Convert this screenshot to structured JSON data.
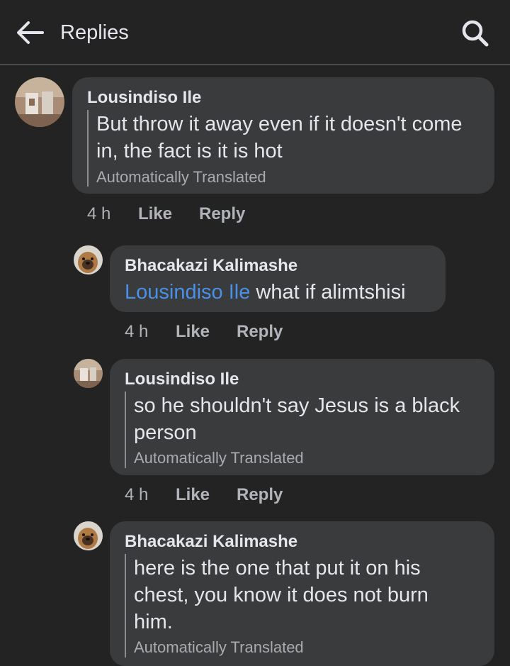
{
  "header": {
    "title": "Replies"
  },
  "actions": {
    "like": "Like",
    "reply": "Reply"
  },
  "comments": [
    {
      "author": "Lousindiso Ile",
      "lines": [
        "But throw it away even if it doesn't come",
        "in, the fact is it is hot"
      ],
      "note": "Automatically Translated",
      "time": "4 h"
    },
    {
      "author": "Bhacakazi Kalimashe",
      "mention": "Lousindiso Ile",
      "text": " what if alimtshisi",
      "time": "4 h"
    },
    {
      "author": "Lousindiso Ile",
      "lines": [
        "so he shouldn't say Jesus is a black",
        "person"
      ],
      "note": "Automatically Translated",
      "time": "4 h"
    },
    {
      "author": "Bhacakazi Kalimashe",
      "lines": [
        "here is the one that put it on his",
        "chest, you know it does not burn",
        "him."
      ],
      "note": "Automatically Translated"
    }
  ]
}
